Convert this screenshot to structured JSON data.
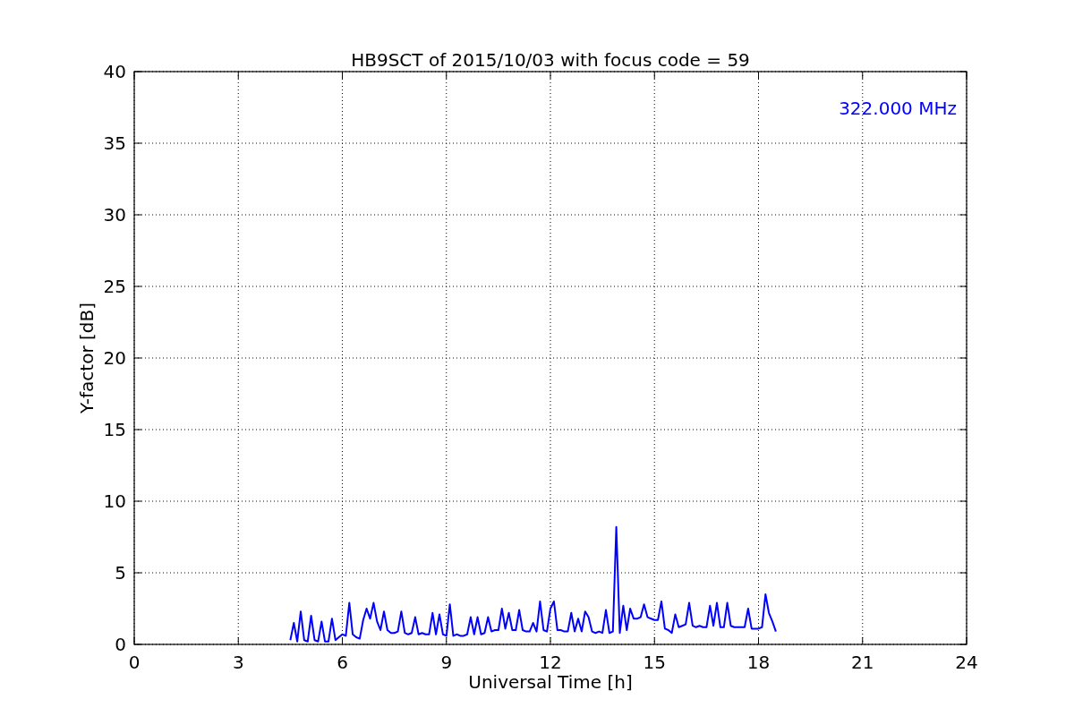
{
  "chart_data": {
    "type": "line",
    "title": "HB9SCT of 2015/10/03 with focus code = 59",
    "xlabel": "Universal Time [h]",
    "ylabel": "Y-factor [dB]",
    "xlim": [
      0,
      24
    ],
    "ylim": [
      0,
      40
    ],
    "xticks": [
      0,
      3,
      6,
      9,
      12,
      15,
      18,
      21,
      24
    ],
    "yticks": [
      0,
      5,
      10,
      15,
      20,
      25,
      30,
      35,
      40
    ],
    "grid": true,
    "x": [
      4.5,
      4.6,
      4.7,
      4.8,
      4.9,
      5.0,
      5.1,
      5.2,
      5.3,
      5.4,
      5.5,
      5.6,
      5.7,
      5.8,
      5.9,
      6.0,
      6.1,
      6.2,
      6.3,
      6.4,
      6.5,
      6.6,
      6.7,
      6.8,
      6.9,
      7.0,
      7.1,
      7.2,
      7.3,
      7.4,
      7.5,
      7.6,
      7.7,
      7.8,
      7.9,
      8.0,
      8.1,
      8.2,
      8.3,
      8.4,
      8.5,
      8.6,
      8.7,
      8.8,
      8.9,
      9.0,
      9.1,
      9.2,
      9.3,
      9.4,
      9.5,
      9.6,
      9.7,
      9.8,
      9.9,
      10.0,
      10.1,
      10.2,
      10.3,
      10.4,
      10.5,
      10.6,
      10.7,
      10.8,
      10.9,
      11.0,
      11.1,
      11.2,
      11.3,
      11.4,
      11.5,
      11.6,
      11.7,
      11.8,
      11.9,
      12.0,
      12.1,
      12.2,
      12.3,
      12.4,
      12.5,
      12.6,
      12.7,
      12.8,
      12.9,
      13.0,
      13.1,
      13.2,
      13.3,
      13.4,
      13.5,
      13.6,
      13.7,
      13.8,
      13.9,
      14.0,
      14.1,
      14.2,
      14.3,
      14.4,
      14.5,
      14.6,
      14.7,
      14.8,
      14.9,
      15.0,
      15.1,
      15.2,
      15.3,
      15.4,
      15.5,
      15.6,
      15.7,
      15.8,
      15.9,
      16.0,
      16.1,
      16.2,
      16.3,
      16.4,
      16.5,
      16.6,
      16.7,
      16.8,
      16.9,
      17.0,
      17.1,
      17.2,
      17.3,
      17.4,
      17.5,
      17.6,
      17.7,
      17.8,
      17.9,
      18.0,
      18.1,
      18.2,
      18.3,
      18.4,
      18.5
    ],
    "series": [
      {
        "name": "322.000 MHz",
        "color": "#0000ff",
        "values": [
          0.3,
          1.5,
          0.2,
          2.3,
          0.3,
          0.2,
          2.0,
          0.3,
          0.2,
          1.6,
          0.2,
          0.2,
          1.8,
          0.3,
          0.5,
          0.7,
          0.6,
          2.9,
          0.7,
          0.5,
          0.4,
          1.7,
          2.5,
          1.8,
          2.9,
          1.6,
          1.0,
          2.3,
          1.0,
          0.8,
          0.8,
          0.9,
          2.3,
          0.8,
          0.7,
          0.8,
          1.9,
          0.7,
          0.8,
          0.7,
          0.7,
          2.2,
          0.7,
          2.1,
          0.7,
          0.6,
          2.8,
          0.6,
          0.7,
          0.6,
          0.6,
          0.7,
          1.9,
          0.7,
          1.9,
          0.7,
          0.8,
          1.9,
          0.9,
          1.0,
          1.0,
          2.5,
          1.1,
          2.2,
          1.0,
          1.0,
          2.4,
          1.0,
          0.9,
          0.9,
          1.5,
          0.9,
          3.0,
          1.0,
          0.9,
          2.5,
          3.0,
          1.0,
          1.0,
          0.9,
          0.9,
          2.2,
          0.9,
          1.8,
          0.9,
          2.3,
          1.9,
          0.9,
          0.8,
          0.9,
          0.8,
          2.4,
          0.8,
          0.9,
          8.2,
          0.8,
          2.7,
          1.0,
          2.5,
          1.8,
          1.8,
          1.9,
          2.8,
          1.9,
          1.8,
          1.7,
          1.7,
          3.0,
          1.1,
          1.0,
          0.8,
          2.1,
          1.2,
          1.3,
          1.4,
          2.9,
          1.3,
          1.2,
          1.3,
          1.2,
          1.2,
          2.7,
          1.3,
          2.9,
          1.2,
          1.2,
          2.9,
          1.3,
          1.2,
          1.2,
          1.2,
          1.2,
          2.5,
          1.1,
          1.1,
          1.1,
          1.2,
          3.5,
          2.2,
          1.6,
          0.9
        ]
      }
    ]
  }
}
